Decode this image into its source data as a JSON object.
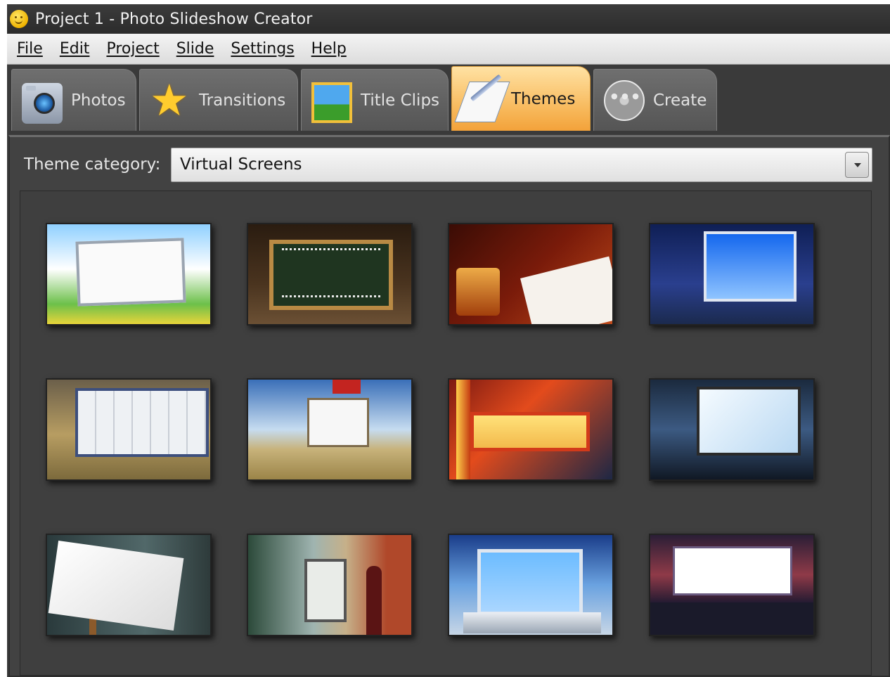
{
  "window": {
    "title": "Project 1 - Photo Slideshow Creator"
  },
  "menu": {
    "items": [
      "File",
      "Edit",
      "Project",
      "Slide",
      "Settings",
      "Help"
    ]
  },
  "tabs": [
    {
      "label": "Photos",
      "icon": "camera-icon",
      "active": false
    },
    {
      "label": "Transitions",
      "icon": "star-icon",
      "active": false
    },
    {
      "label": "Title Clips",
      "icon": "picture-icon",
      "active": false
    },
    {
      "label": "Themes",
      "icon": "pen-notepad-icon",
      "active": true
    },
    {
      "label": "Create",
      "icon": "film-reel-icon",
      "active": false
    }
  ],
  "theme_category": {
    "label": "Theme category:",
    "selected": "Virtual Screens"
  },
  "themes": [
    {
      "id": 1
    },
    {
      "id": 2
    },
    {
      "id": 3
    },
    {
      "id": 4
    },
    {
      "id": 5
    },
    {
      "id": 6
    },
    {
      "id": 7
    },
    {
      "id": 8
    },
    {
      "id": 9
    },
    {
      "id": 10
    },
    {
      "id": 11
    },
    {
      "id": 12
    }
  ],
  "colors": {
    "accent_tab": "#f7b657",
    "panel_bg": "#424242",
    "titlebar_bg": "#2b2b2b"
  }
}
